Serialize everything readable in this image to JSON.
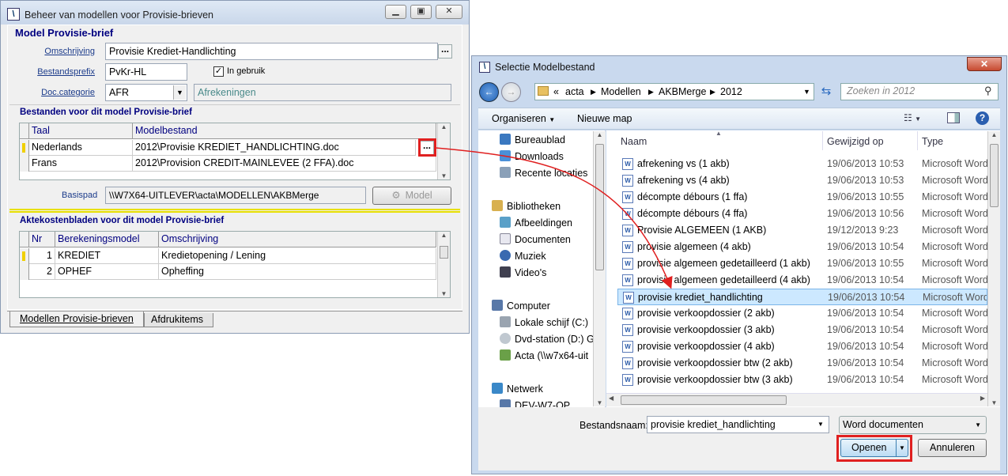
{
  "win1": {
    "title": "Beheer van modellen voor Provisie-brieven",
    "section_main": "Model Provisie-brief",
    "omschrijving_label": "Omschrijving",
    "omschrijving_value": "Provisie Krediet-Handlichting",
    "prefix_label": "Bestandsprefix",
    "prefix_value": "PvKr-HL",
    "in_gebruik_label": "In gebruik",
    "doccat_label": "Doc.categorie",
    "doccat_value": "AFR",
    "doccat_desc": "Afrekeningen",
    "section_files": "Bestanden voor dit model Provisie-brief",
    "files_headers": {
      "taal": "Taal",
      "model": "Modelbestand"
    },
    "files_rows": [
      {
        "taal": "Nederlands",
        "model": "2012\\Provisie KREDIET_HANDLICHTING.doc"
      },
      {
        "taal": "Frans",
        "model": "2012\\Provision CREDIT-MAINLEVEE (2 FFA).doc"
      }
    ],
    "basispad_label": "Basispad",
    "basispad_value": "\\\\W7X64-UITLEVER\\acta\\MODELLEN\\AKBMerge",
    "model_button": "Model",
    "section_akte": "Aktekostenbladen voor dit model Provisie-brief",
    "akte_headers": {
      "nr": "Nr",
      "ber": "Berekeningsmodel",
      "oms": "Omschrijving"
    },
    "akte_rows": [
      {
        "nr": "1",
        "ber": "KREDIET",
        "oms": "Kredietopening / Lening"
      },
      {
        "nr": "2",
        "ber": "OPHEF",
        "oms": "Opheffing"
      }
    ],
    "tabs": [
      "Modellen Provisie-brieven",
      "Afdrukitems"
    ]
  },
  "win2": {
    "title": "Selectie Modelbestand",
    "breadcrumb": [
      "«",
      "acta",
      "Modellen",
      "AKBMerge",
      "2012"
    ],
    "search_placeholder": "Zoeken in 2012",
    "organize_label": "Organiseren",
    "new_folder_label": "Nieuwe map",
    "nav": {
      "favorites": [
        "Bureaublad",
        "Downloads",
        "Recente locaties"
      ],
      "libraries_label": "Bibliotheken",
      "libraries": [
        "Afbeeldingen",
        "Documenten",
        "Muziek",
        "Video's"
      ],
      "computer_label": "Computer",
      "drives": [
        "Lokale schijf (C:)",
        "Dvd-station (D:) G",
        "Acta (\\\\w7x64-uit"
      ],
      "network_label": "Netwerk",
      "network": [
        "DEV-W7-QP"
      ]
    },
    "columns": {
      "name": "Naam",
      "date": "Gewijzigd op",
      "type": "Type"
    },
    "files": [
      {
        "name": "afrekening vs (1 akb)",
        "date": "19/06/2013 10:53",
        "type": "Microsoft Word"
      },
      {
        "name": "afrekening vs (4 akb)",
        "date": "19/06/2013 10:53",
        "type": "Microsoft Word"
      },
      {
        "name": "décompte débours (1 ffa)",
        "date": "19/06/2013 10:55",
        "type": "Microsoft Word"
      },
      {
        "name": "décompte débours (4 ffa)",
        "date": "19/06/2013 10:56",
        "type": "Microsoft Word"
      },
      {
        "name": "Provisie ALGEMEEN (1 AKB)",
        "date": "19/12/2013 9:23",
        "type": "Microsoft Word"
      },
      {
        "name": "provisie algemeen (4 akb)",
        "date": "19/06/2013 10:54",
        "type": "Microsoft Word"
      },
      {
        "name": "provisie algemeen gedetailleerd (1 akb)",
        "date": "19/06/2013 10:55",
        "type": "Microsoft Word"
      },
      {
        "name": "provisie algemeen gedetailleerd (4 akb)",
        "date": "19/06/2013 10:54",
        "type": "Microsoft Word"
      },
      {
        "name": "provisie krediet_handlichting",
        "date": "19/06/2013 10:54",
        "type": "Microsoft Word"
      },
      {
        "name": "provisie verkoopdossier (2 akb)",
        "date": "19/06/2013 10:54",
        "type": "Microsoft Word"
      },
      {
        "name": "provisie verkoopdossier (3 akb)",
        "date": "19/06/2013 10:54",
        "type": "Microsoft Word"
      },
      {
        "name": "provisie verkoopdossier (4 akb)",
        "date": "19/06/2013 10:54",
        "type": "Microsoft Word"
      },
      {
        "name": "provisie verkoopdossier btw (2 akb)",
        "date": "19/06/2013 10:54",
        "type": "Microsoft Word"
      },
      {
        "name": "provisie verkoopdossier btw (3 akb)",
        "date": "19/06/2013 10:54",
        "type": "Microsoft Word"
      }
    ],
    "selected_index": 8,
    "filename_label": "Bestandsnaam:",
    "filename_value": "provisie krediet_handlichting",
    "filetype_value": "Word documenten",
    "open_button": "Openen",
    "cancel_button": "Annuleren"
  },
  "colors": {
    "accent_red": "#e02020",
    "section_blue": "#000080",
    "selection": "#cce8ff"
  }
}
